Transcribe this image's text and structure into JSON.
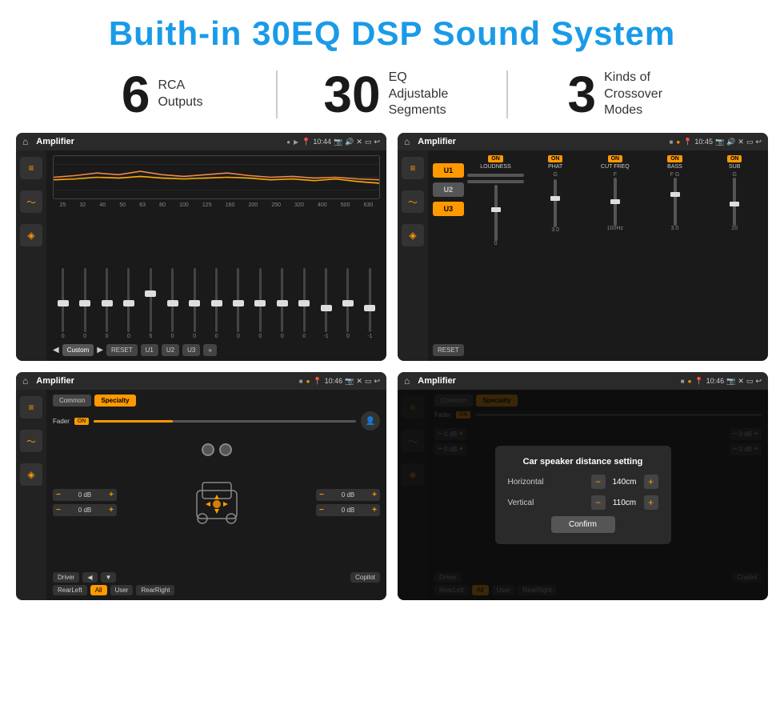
{
  "header": {
    "title": "Buith-in 30EQ DSP Sound System"
  },
  "stats": [
    {
      "number": "6",
      "text": "RCA\nOutputs"
    },
    {
      "number": "30",
      "text": "EQ Adjustable\nSegments"
    },
    {
      "number": "3",
      "text": "Kinds of\nCrossover Modes"
    }
  ],
  "screens": [
    {
      "id": "eq-screen",
      "time": "10:44",
      "app": "Amplifier",
      "type": "eq"
    },
    {
      "id": "crossover-screen",
      "time": "10:45",
      "app": "Amplifier",
      "type": "crossover"
    },
    {
      "id": "specialty-screen",
      "time": "10:46",
      "app": "Amplifier",
      "type": "specialty"
    },
    {
      "id": "dialog-screen",
      "time": "10:46",
      "app": "Amplifier",
      "type": "dialog"
    }
  ],
  "eq": {
    "frequencies": [
      "25",
      "32",
      "40",
      "50",
      "63",
      "80",
      "100",
      "125",
      "160",
      "200",
      "250",
      "320",
      "400",
      "500",
      "630"
    ],
    "values": [
      "0",
      "0",
      "0",
      "0",
      "5",
      "0",
      "0",
      "0",
      "0",
      "0",
      "0",
      "0",
      "-1",
      "0",
      "-1"
    ],
    "preset": "Custom",
    "buttons": [
      "RESET",
      "U1",
      "U2",
      "U3"
    ]
  },
  "crossover": {
    "u_buttons": [
      "U1",
      "U2",
      "U3"
    ],
    "channels": [
      "LOUDNESS",
      "PHAT",
      "CUT FREQ",
      "BASS",
      "SUB"
    ],
    "reset": "RESET"
  },
  "specialty": {
    "tabs": [
      "Common",
      "Specialty"
    ],
    "active_tab": "Specialty",
    "fader_label": "Fader",
    "fader_on": "ON",
    "zones": [
      "Driver",
      "Copilot",
      "RearLeft",
      "All",
      "User",
      "RearRight"
    ],
    "db_values": [
      "0 dB",
      "0 dB",
      "0 dB",
      "0 dB"
    ]
  },
  "dialog": {
    "title": "Car speaker distance setting",
    "horizontal_label": "Horizontal",
    "horizontal_value": "140cm",
    "vertical_label": "Vertical",
    "vertical_value": "110cm",
    "confirm_label": "Confirm",
    "db_values": [
      "0 dB",
      "0 dB"
    ]
  }
}
